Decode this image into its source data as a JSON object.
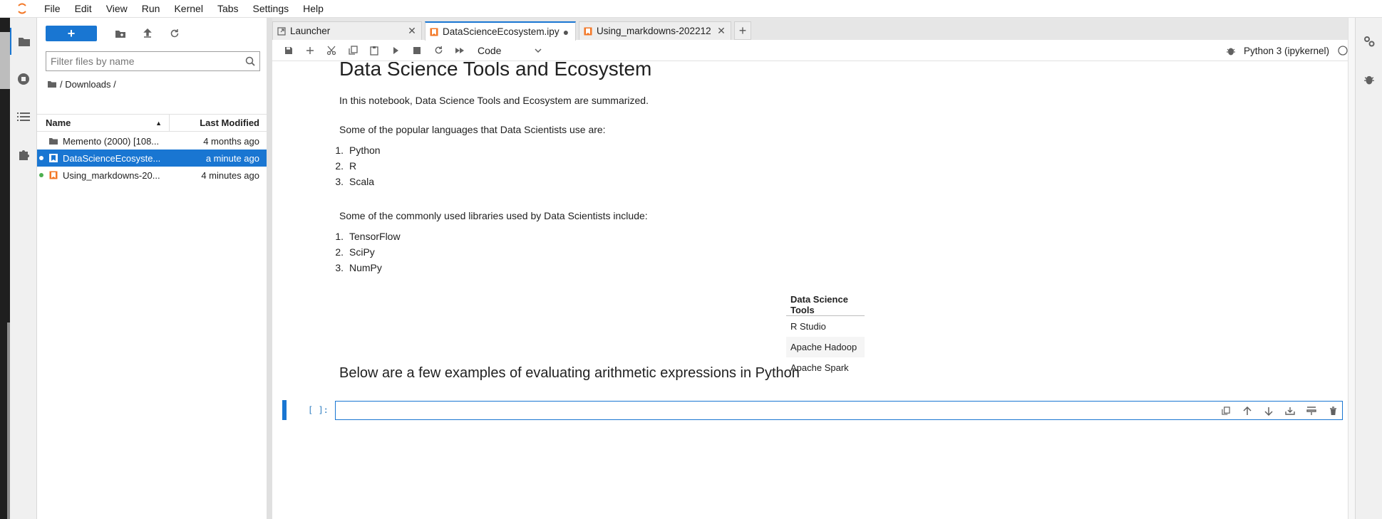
{
  "menu": [
    "File",
    "Edit",
    "View",
    "Run",
    "Kernel",
    "Tabs",
    "Settings",
    "Help"
  ],
  "filebrowser": {
    "new_label": "+",
    "search_placeholder": "Filter files by name",
    "breadcrumb": "/ Downloads /",
    "col_name": "Name",
    "col_modified": "Last Modified",
    "files": [
      {
        "name": "Memento (2000) [108...",
        "modified": "4 months ago",
        "type": "folder",
        "running": false
      },
      {
        "name": "DataScienceEcosyste...",
        "modified": "a minute ago",
        "type": "notebook",
        "running": true
      },
      {
        "name": "Using_markdowns-20...",
        "modified": "4 minutes ago",
        "type": "notebook",
        "running": true
      }
    ]
  },
  "tabs": [
    {
      "label": "Launcher",
      "active": false
    },
    {
      "label": "DataScienceEcosystem.ipy",
      "active": true
    },
    {
      "label": "Using_markdowns-202212",
      "active": false
    }
  ],
  "toolbar": {
    "cell_type": "Code",
    "kernel": "Python 3 (ipykernel)"
  },
  "notebook": {
    "title": "Data Science Tools and Ecosystem",
    "intro": "In this notebook, Data Science Tools and Ecosystem are summarized.",
    "languages_intro": "Some of the popular languages that Data Scientists use are:",
    "languages": [
      "Python",
      "R",
      "Scala"
    ],
    "libraries_intro": "Some of the commonly used libraries used by Data Scientists include:",
    "libraries": [
      "TensorFlow",
      "SciPy",
      "NumPy"
    ],
    "table_header": "Data Science Tools",
    "table_rows": [
      "R Studio",
      "Apache Hadoop",
      "Apache Spark"
    ],
    "arith_heading": "Below are a few examples of evaluating arithmetic expressions in Python",
    "prompt": "[ ]:"
  },
  "colors": {
    "accent": "#1976d2",
    "running_dot": "#4caf50"
  }
}
